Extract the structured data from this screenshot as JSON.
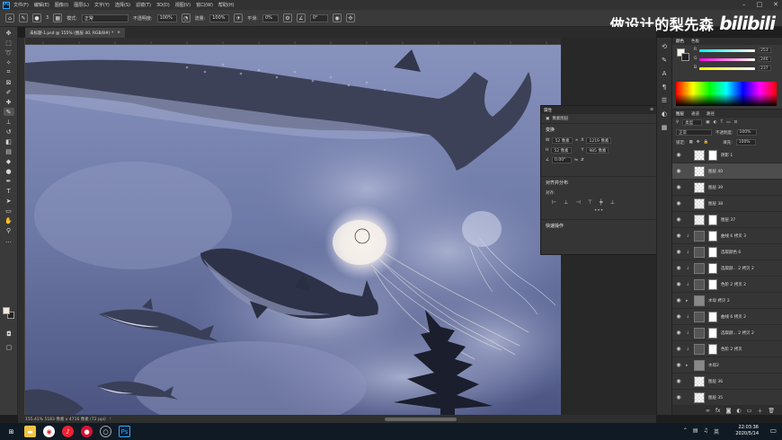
{
  "menubar": {
    "app_icon": "Ps",
    "items": [
      "文件(F)",
      "编辑(E)",
      "图像(I)",
      "图层(L)",
      "文字(Y)",
      "选择(S)",
      "滤镜(T)",
      "3D(D)",
      "视图(V)",
      "窗口(W)",
      "帮助(H)"
    ]
  },
  "options": {
    "mode_label": "模式:",
    "mode_value": "正常",
    "opacity_label": "不透明度:",
    "opacity_value": "100%",
    "flow_label": "流量:",
    "flow_value": "100%",
    "smooth_label": "平滑:",
    "smooth_value": "0%",
    "angle_value": "0°",
    "brush_size": "3"
  },
  "watermark": {
    "text": "做设计的梨先森",
    "logo": "bilibili"
  },
  "document": {
    "tab_title": "未标题-1.psd @ 155% (图层 40, RGB/8#) *",
    "status": "155.41%    5183 像素 x 4716 像素 (72 ppi)"
  },
  "properties": {
    "tabs": [
      "属性"
    ],
    "layer_type": "像素图层",
    "transform_title": "变换",
    "w_label": "W",
    "w_value": "52 像素",
    "x_label": "X",
    "x_value": "1219 像素",
    "h_label": "H",
    "h_value": "52 像素",
    "y_label": "Y",
    "y_value": "985 像素",
    "angle_value": "0.00°",
    "align_title": "对齐并分布",
    "align_sub": "对齐:",
    "quick_title": "快速操作"
  },
  "color_panel": {
    "tabs": [
      "颜色",
      "色板"
    ],
    "r_value": "253",
    "g_value": "246",
    "b_value": "237"
  },
  "layers_panel": {
    "tabs": [
      "图层",
      "通道",
      "路径"
    ],
    "kind_label": "类型",
    "blend_mode": "正常",
    "opacity_label": "不透明度:",
    "opacity_value": "100%",
    "lock_label": "锁定:",
    "fill_label": "填充:",
    "fill_value": "100%",
    "layers": [
      {
        "name": "阴影 1",
        "type": "mask",
        "selected": false
      },
      {
        "name": "图层 40",
        "type": "pixel",
        "selected": true
      },
      {
        "name": "图层 39",
        "type": "pixel",
        "selected": false
      },
      {
        "name": "图层 38",
        "type": "pixel",
        "selected": false
      },
      {
        "name": "图层 37",
        "type": "mask",
        "selected": false
      },
      {
        "name": "曲线 6 拷贝 3",
        "type": "adj",
        "selected": false
      },
      {
        "name": "选取颜色 6",
        "type": "adj",
        "selected": false
      },
      {
        "name": "选取颜... 2 拷贝 2",
        "type": "adj",
        "selected": false
      },
      {
        "name": "色阶 2 拷贝 2",
        "type": "adj",
        "selected": false
      },
      {
        "name": "水母 拷贝 2",
        "type": "group",
        "selected": false
      },
      {
        "name": "曲线 6 拷贝 2",
        "type": "adj",
        "selected": false
      },
      {
        "name": "选取颜... 2 拷贝 2",
        "type": "adj",
        "selected": false
      },
      {
        "name": "色阶 2 拷贝",
        "type": "adj",
        "selected": false
      },
      {
        "name": "水母2",
        "type": "group",
        "selected": false
      },
      {
        "name": "图层 36",
        "type": "pixel",
        "selected": false
      },
      {
        "name": "图层 35",
        "type": "pixel",
        "selected": false
      }
    ]
  },
  "taskbar": {
    "time": "22:03:36",
    "date": "2020/5/14"
  }
}
